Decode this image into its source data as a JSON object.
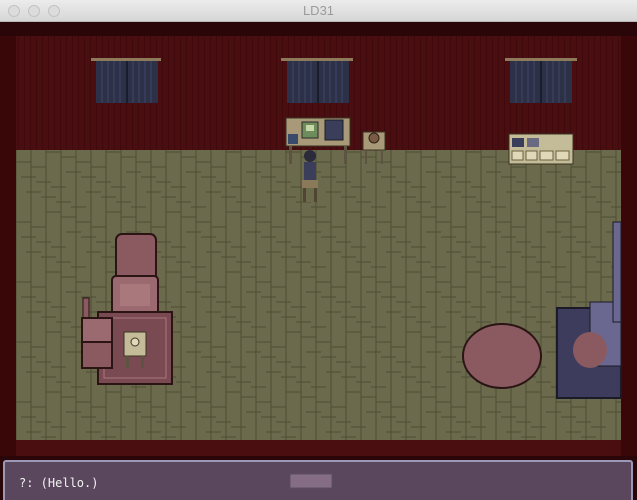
{
  "window": {
    "title": "LD31"
  },
  "dialogue": {
    "text": "?: (Hello.)"
  },
  "colors": {
    "wall": "#4a0d10",
    "floor": "#6b6a4c",
    "floor_line": "#4e4d36",
    "curtain": "#2c3148",
    "furniture": "#8a5a60",
    "dialogue_bg": "#827da5"
  },
  "scene": {
    "objects": [
      "window-curtain",
      "window-curtain",
      "window-curtain",
      "desk",
      "computer",
      "chair",
      "side-table",
      "kitchen-counter",
      "armchair",
      "rug",
      "round-table",
      "sofa",
      "player-character"
    ]
  }
}
